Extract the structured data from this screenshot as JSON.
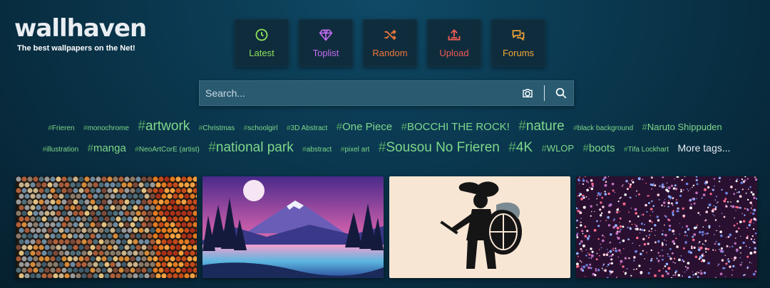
{
  "brand": {
    "logo": "wallhaven",
    "tagline": "The best wallpapers on the Net!"
  },
  "nav": [
    {
      "id": "latest",
      "label": "Latest",
      "color": "#8fe05a",
      "icon": "clock-icon"
    },
    {
      "id": "toplist",
      "label": "Toplist",
      "color": "#c26cf0",
      "icon": "diamond-icon"
    },
    {
      "id": "random",
      "label": "Random",
      "color": "#f0763a",
      "icon": "shuffle-icon"
    },
    {
      "id": "upload",
      "label": "Upload",
      "color": "#ef5a52",
      "icon": "upload-icon"
    },
    {
      "id": "forums",
      "label": "Forums",
      "color": "#f2a735",
      "icon": "comments-icon"
    }
  ],
  "search": {
    "placeholder": "Search...",
    "camera_icon": "camera-icon",
    "search_icon": "search-icon"
  },
  "tags": {
    "hash": "#",
    "items": [
      {
        "label": "Frieren",
        "size": "s"
      },
      {
        "label": "monochrome",
        "size": "s"
      },
      {
        "label": "artwork",
        "size": "xl"
      },
      {
        "label": "Christmas",
        "size": "s"
      },
      {
        "label": "schoolgirl",
        "size": "s"
      },
      {
        "label": "3D Abstract",
        "size": "s"
      },
      {
        "label": "One Piece",
        "size": "l"
      },
      {
        "label": "BOCCHI THE ROCK!",
        "size": "l"
      },
      {
        "label": "nature",
        "size": "xl"
      },
      {
        "label": "black background",
        "size": "s"
      },
      {
        "label": "Naruto Shippuden",
        "size": "m"
      },
      {
        "label": "illustration",
        "size": "s"
      },
      {
        "label": "manga",
        "size": "l"
      },
      {
        "label": "NeoArtCorE (artist)",
        "size": "s"
      },
      {
        "label": "national park",
        "size": "xl"
      },
      {
        "label": "abstract",
        "size": "s"
      },
      {
        "label": "pixel art",
        "size": "s"
      },
      {
        "label": "Sousou No Frieren",
        "size": "xl"
      },
      {
        "label": "4K",
        "size": "xl"
      },
      {
        "label": "WLOP",
        "size": "m"
      },
      {
        "label": "boots",
        "size": "l"
      },
      {
        "label": "Tifa Lockhart",
        "size": "s"
      }
    ],
    "more_label": "More tags..."
  },
  "thumbnails": [
    {
      "id": "spheres"
    },
    {
      "id": "mountain-lake"
    },
    {
      "id": "warrior-silhouette"
    },
    {
      "id": "particles"
    }
  ]
}
